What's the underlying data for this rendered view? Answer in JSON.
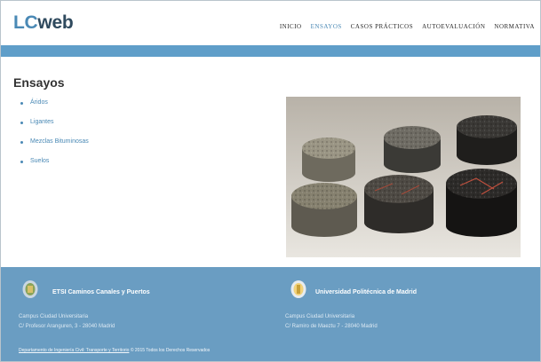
{
  "header": {
    "logo_lc": "LC",
    "logo_web": "web",
    "nav": [
      {
        "label": "INICIO",
        "active": false
      },
      {
        "label": "ENSAYOS",
        "active": true
      },
      {
        "label": "CASOS PRÁCTICOS",
        "active": false
      },
      {
        "label": "AUTOEVALUACIÓN",
        "active": false
      },
      {
        "label": "NORMATIVA",
        "active": false
      }
    ]
  },
  "main": {
    "title": "Ensayos",
    "list": [
      "Áridos",
      "Ligantes",
      "Mezclas Bituminosas",
      "Suelos"
    ]
  },
  "footer": {
    "left": {
      "name": "ETSI Caminos Canales y Puertos",
      "line1": "Campus Ciudad Universitaria",
      "line2": "C/ Profesor Aranguren, 3 - 28040 Madrid"
    },
    "right": {
      "name": "Universidad Politécnica de Madrid",
      "line1": "Campus Ciudad Universitaria",
      "line2": "C/ Ramiro de Maeztu 7 - 28040 Madrid"
    },
    "bottom_link": "Departamento de Ingeniería Civil: Transporte y Territorio",
    "bottom_rest": "© 2015 Todos los Derechos Reservados"
  },
  "colors": {
    "accent": "#4a89b5",
    "bar": "#5f9ec9",
    "footer": "#6a9dc2"
  }
}
